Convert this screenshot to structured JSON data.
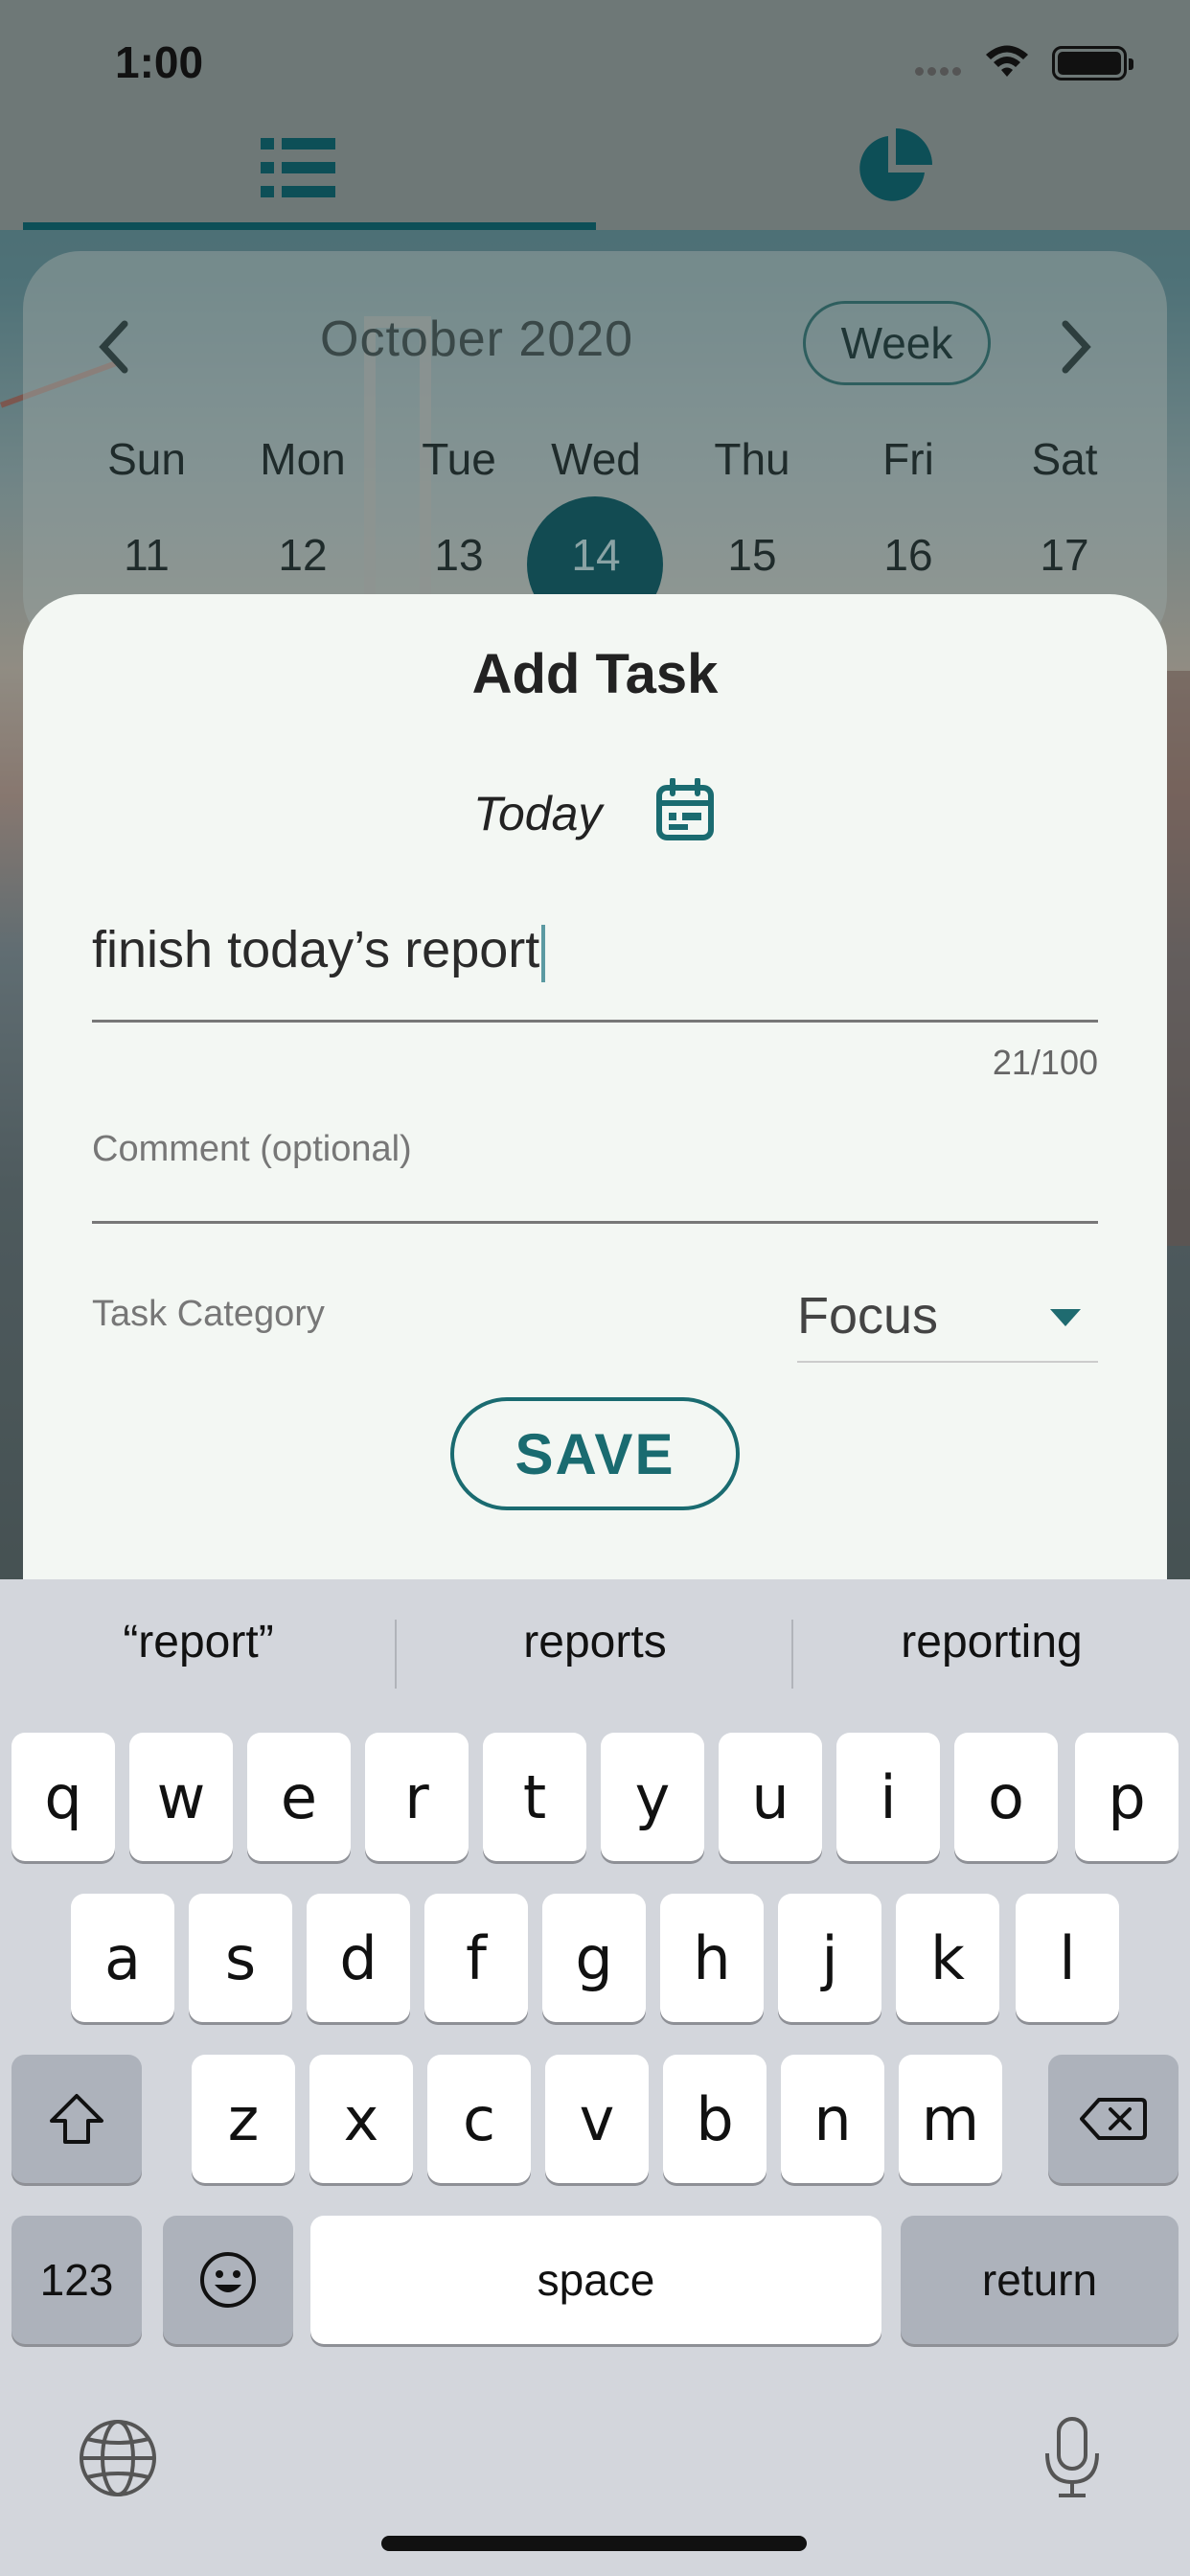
{
  "status_bar": {
    "time": "1:00"
  },
  "tabs": [
    {
      "name": "list",
      "icon": "list-icon",
      "active": true
    },
    {
      "name": "stats",
      "icon": "pie-chart-icon",
      "active": false
    }
  ],
  "calendar": {
    "month_label": "October 2020",
    "view_toggle": "Week",
    "weekdays": [
      "Sun",
      "Mon",
      "Tue",
      "Wed",
      "Thu",
      "Fri",
      "Sat"
    ],
    "dates": [
      "11",
      "12",
      "13",
      "14",
      "15",
      "16",
      "17"
    ],
    "selected_date": "14"
  },
  "add_task": {
    "title": "Add Task",
    "date_label": "Today",
    "task_value": "finish today’s report",
    "char_counter": "21/100",
    "comment_placeholder": "Comment (optional)",
    "category_label": "Task Category",
    "category_value": "Focus",
    "save_label": "SAVE"
  },
  "keyboard": {
    "suggestions": [
      "“report”",
      "reports",
      "reporting"
    ],
    "row1": [
      "q",
      "w",
      "e",
      "r",
      "t",
      "y",
      "u",
      "i",
      "o",
      "p"
    ],
    "row2": [
      "a",
      "s",
      "d",
      "f",
      "g",
      "h",
      "j",
      "k",
      "l"
    ],
    "row3": [
      "z",
      "x",
      "c",
      "v",
      "b",
      "n",
      "m"
    ],
    "numbers_key": "123",
    "space_key": "space",
    "return_key": "return"
  },
  "colors": {
    "accent": "#1a6b70",
    "dark_teal": "#0d4f57",
    "sheet_bg": "#f3f7f3",
    "keyboard_bg": "#d3d6dc"
  }
}
